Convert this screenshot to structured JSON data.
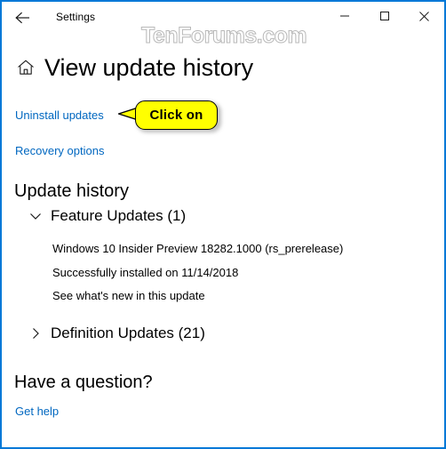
{
  "window": {
    "app_title": "Settings",
    "border_color": "#0078d7",
    "back_icon": "back-arrow-icon",
    "controls": [
      {
        "name": "minimize",
        "icon": "minimize-icon"
      },
      {
        "name": "maximize",
        "icon": "maximize-icon"
      },
      {
        "name": "close",
        "icon": "close-icon"
      }
    ]
  },
  "watermark": {
    "text": "TenForums.com"
  },
  "page": {
    "home_icon": "home-icon",
    "title": "View update history"
  },
  "links": {
    "uninstall_updates": "Uninstall updates",
    "recovery_options": "Recovery options",
    "get_help": "Get help"
  },
  "callout": {
    "text": "Click on",
    "fill_color": "#ffff00",
    "border_color": "#000000"
  },
  "update_history": {
    "heading": "Update history",
    "groups": [
      {
        "label": "Feature Updates (1)",
        "expanded": true,
        "chevron": "chevron-down-icon",
        "items": [
          {
            "name": "Windows 10 Insider Preview 18282.1000 (rs_prerelease)",
            "status": "Successfully installed on 11/14/2018",
            "link": "See what's new in this update"
          }
        ]
      },
      {
        "label": "Definition Updates (21)",
        "expanded": false,
        "chevron": "chevron-right-icon",
        "items": []
      }
    ]
  },
  "question": {
    "heading": "Have a question?"
  },
  "colors": {
    "link": "#0067c0",
    "text": "#000000",
    "accent_border": "#0078d7"
  }
}
